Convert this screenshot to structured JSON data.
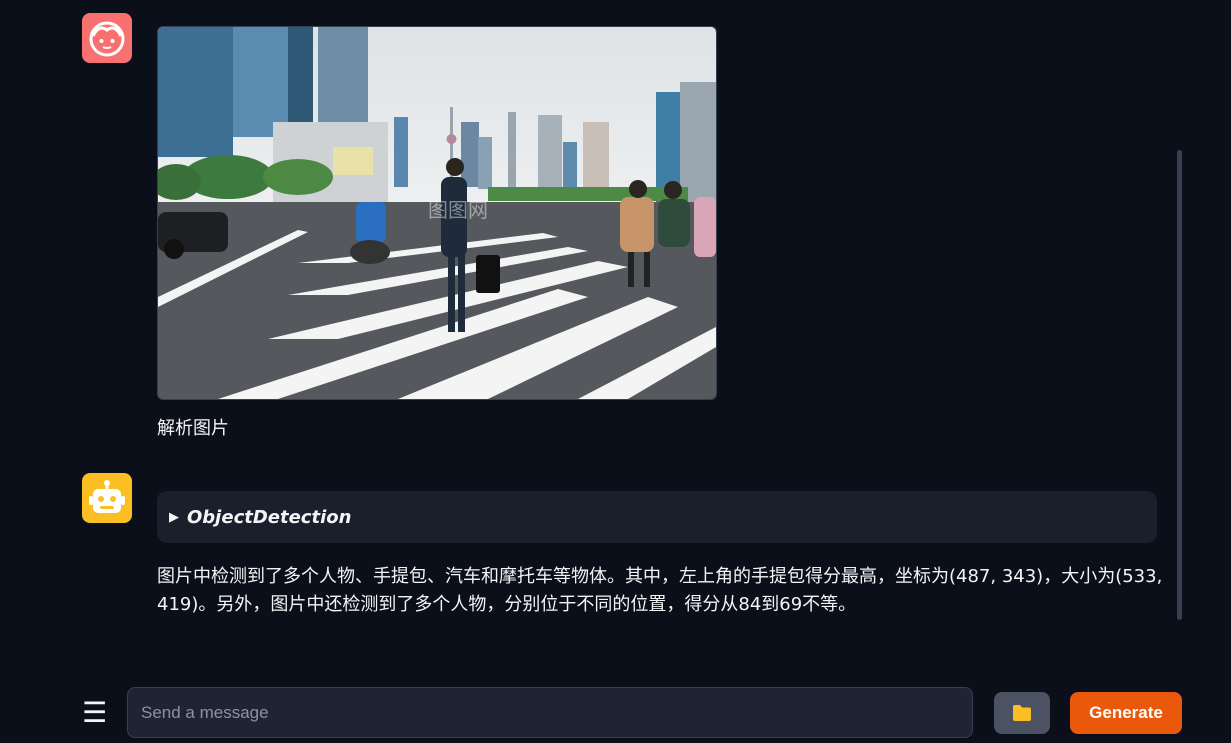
{
  "chat": {
    "user_message": {
      "avatar_icon": "user-face-icon",
      "image_watermark": "图图网",
      "text": "解析图片"
    },
    "bot_message": {
      "avatar_icon": "robot-icon",
      "accordion_title": "ObjectDetection",
      "text": "图片中检测到了多个人物、手提包、汽车和摩托车等物体。其中，左上角的手提包得分最高，坐标为(487, 343)，大小为(533, 419)。另外，图片中还检测到了多个人物，分别位于不同的位置，得分从84到69不等。"
    }
  },
  "composer": {
    "menu_icon": "☰",
    "placeholder": "Send a message",
    "upload_icon": "folder-icon",
    "generate_label": "Generate"
  },
  "colors": {
    "background": "#0b0f19",
    "user_avatar": "#f87171",
    "bot_avatar": "#fbbf24",
    "generate": "#ea580c"
  }
}
